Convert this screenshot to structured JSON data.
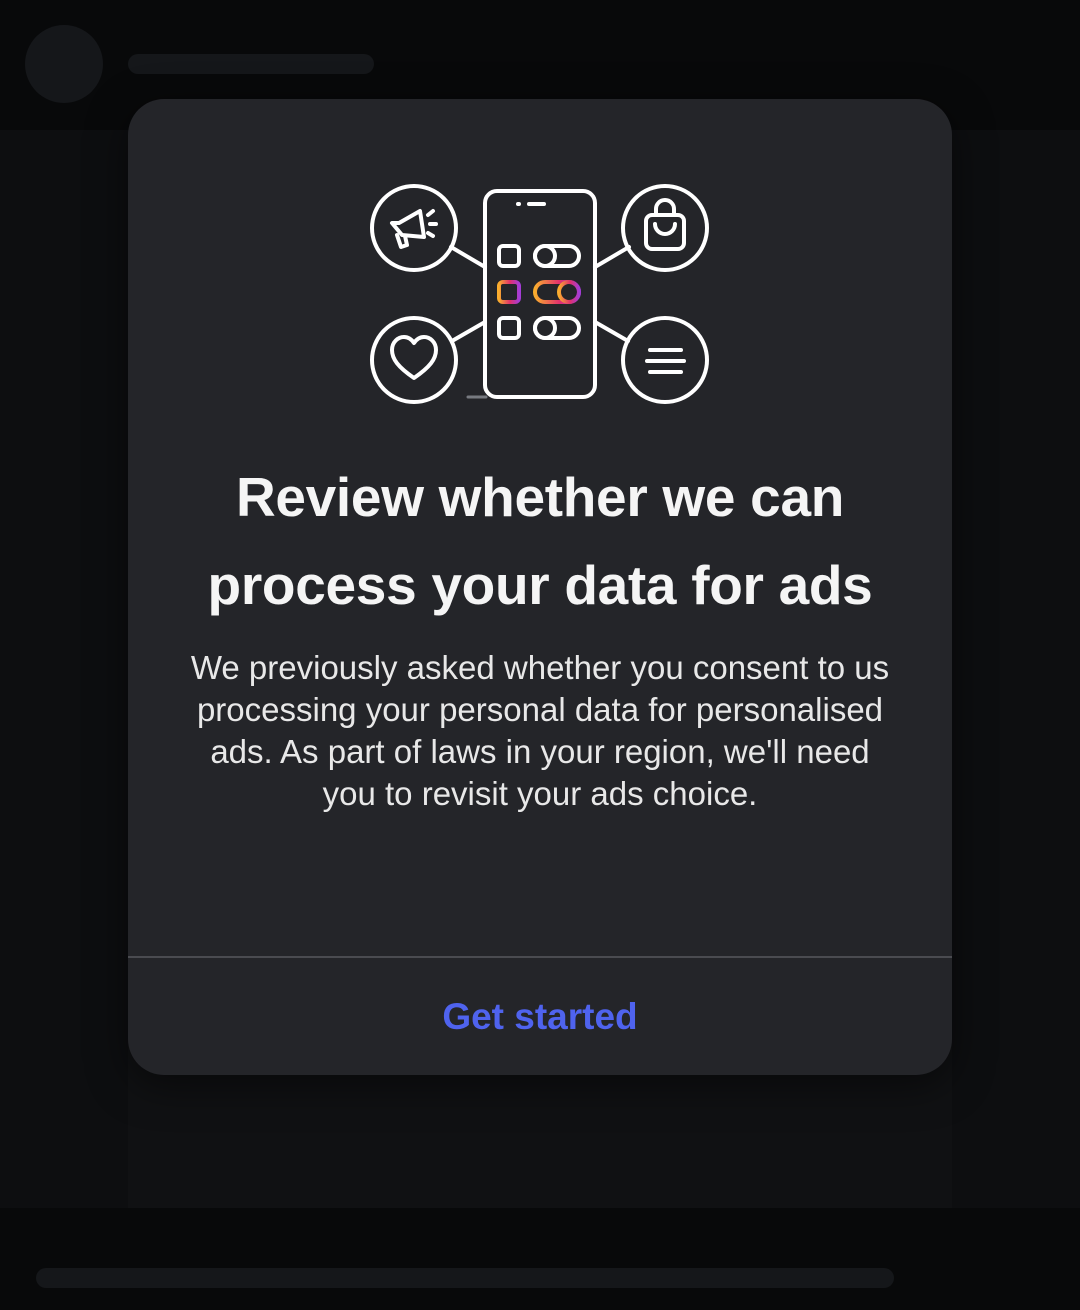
{
  "dialog": {
    "title": "Review whether we can process your data for ads",
    "body": "We previously asked whether you consent to us processing your personal data for personalised ads. As part of laws in your region, we'll need you to revisit your ads choice.",
    "primary_action_label": "Get started"
  },
  "illustration": {
    "icons": [
      "megaphone-icon",
      "shopping-bag-icon",
      "heart-icon",
      "list-icon",
      "phone-icon"
    ],
    "highlighted_toggle_gradient": [
      "#f9ad2e",
      "#e1306c",
      "#a43dd6"
    ]
  },
  "colors": {
    "modal_background": "#242529",
    "page_background": "#0f1012",
    "title_text": "#f5f5f5",
    "body_text": "#e8e8e8",
    "action_accent": "#4f63ee",
    "divider": "#4a4b50"
  }
}
